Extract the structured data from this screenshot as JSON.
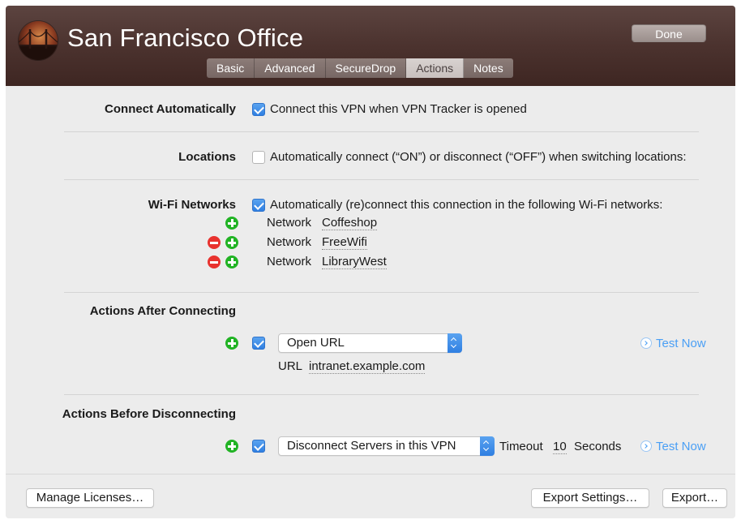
{
  "header": {
    "title": "San Francisco Office",
    "done_label": "Done",
    "tabs": [
      {
        "label": "Basic",
        "active": false
      },
      {
        "label": "Advanced",
        "active": false
      },
      {
        "label": "SecureDrop",
        "active": false
      },
      {
        "label": "Actions",
        "active": true
      },
      {
        "label": "Notes",
        "active": false
      }
    ]
  },
  "connect_automatically": {
    "label": "Connect Automatically",
    "checkbox_label": "Connect this VPN when VPN Tracker is opened",
    "checked": true
  },
  "locations": {
    "label": "Locations",
    "checkbox_label": "Automatically connect (“ON”) or disconnect (“OFF”) when switching locations:",
    "checked": false
  },
  "wifi": {
    "label": "Wi-Fi Networks",
    "checkbox_label": "Automatically (re)connect this connection in the following Wi-Fi networks:",
    "checked": true,
    "network_prefix": "Network",
    "networks": [
      "Coffeshop",
      "FreeWifi",
      "LibraryWest"
    ]
  },
  "after_connecting": {
    "label": "Actions After Connecting",
    "checked": true,
    "action": "Open URL",
    "url_label": "URL",
    "url_value": "intranet.example.com",
    "test_now": "Test Now"
  },
  "before_disconnecting": {
    "label": "Actions Before Disconnecting",
    "checked": true,
    "action": "Disconnect Servers in this VPN",
    "timeout_label": "Timeout",
    "timeout_value": "10",
    "seconds_label": "Seconds",
    "test_now": "Test Now"
  },
  "footer": {
    "manage_licenses": "Manage Licenses…",
    "export_settings": "Export Settings…",
    "export": "Export…"
  },
  "colors": {
    "accent": "#2f7fe2",
    "link": "#4a9ff5",
    "add": "#21b324",
    "remove": "#e8322e"
  }
}
